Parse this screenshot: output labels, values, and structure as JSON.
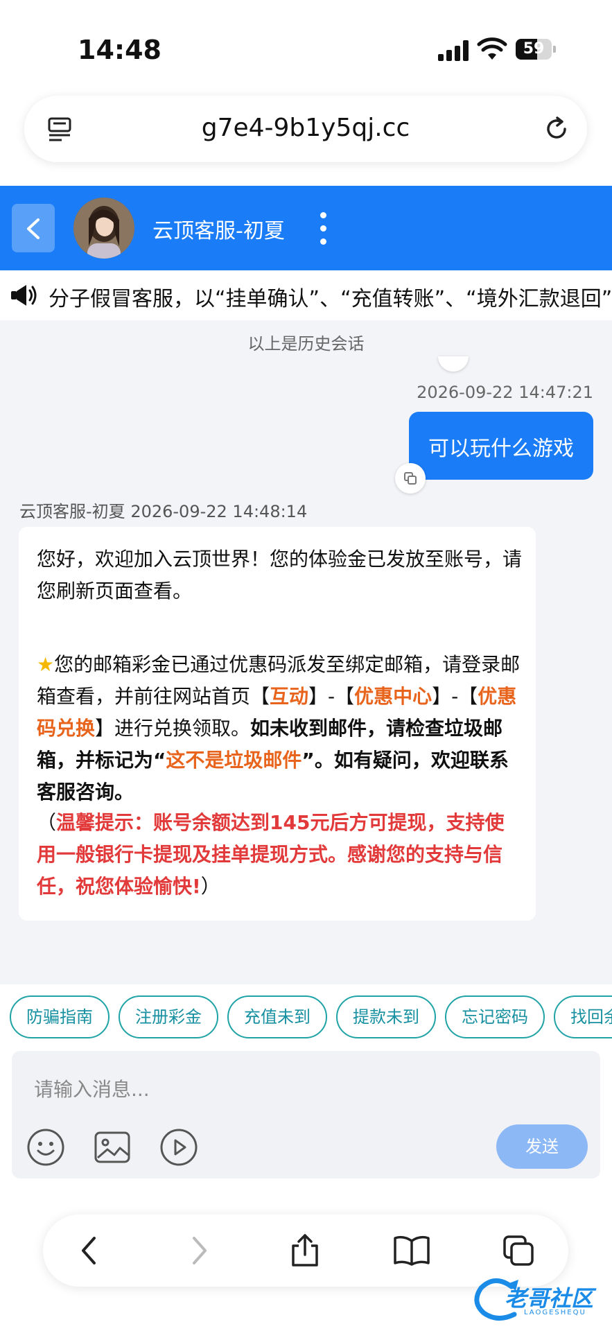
{
  "status_bar": {
    "time": "14:48",
    "battery": "59",
    "battery_level": 0.59
  },
  "browser": {
    "url": "g7e4-9b1y5qj.cc"
  },
  "chat_header": {
    "agent_name": "云顶客服-初夏"
  },
  "notice": {
    "text": "分子假冒客服，以“挂单确认”、“充值转账”、“境外汇款退回”"
  },
  "chat": {
    "history_label": "以上是历史会话",
    "user_message": {
      "timestamp": "2026-09-22 14:47:21",
      "text": "可以玩什么游戏"
    },
    "agent_message": {
      "sender": "云顶客服-初夏",
      "timestamp": "2026-09-22 14:48:14",
      "p1": "您好，欢迎加入云顶世界！您的体验金已发放至账号，请您刷新页面查看。",
      "p2_icon": "star-emoji",
      "p2_a": "您的邮箱彩金已通过优惠码派发至绑定邮箱，请登录邮箱查看，并前往网站首页【",
      "p2_hl1": "互动",
      "p2_b": "】-【",
      "p2_hl2": "优惠中心",
      "p2_c": "】-【",
      "p2_hl3": "优惠码兑换",
      "p2_d": "】进行兑换领取。",
      "p2_bold1": "如未收到邮件，请检查垃圾邮箱，并标记为“",
      "p2_hl4": "这不是垃圾邮件",
      "p2_bold2": "”。如有疑问，欢迎联系客服咨询。",
      "p3_open": "（",
      "p3_red": "温馨提示：账号余额达到145元后方可提现，支持使用一般银行卡提现及挂单提现方式。感谢您的支持与信任，祝您体验愉快!",
      "p3_close": "）"
    }
  },
  "quick_replies": [
    "防骗指南",
    "注册彩金",
    "充值未到",
    "提款未到",
    "忘记密码",
    "找回余额"
  ],
  "input": {
    "placeholder": "请输入消息...",
    "send_label": "发送"
  },
  "watermark": {
    "text": "老哥社区",
    "sub": "LAOGESHEQU"
  },
  "colors": {
    "accent": "#1a7cf7",
    "chip_border": "#1fa3a6",
    "highlight_orange": "#e8641c",
    "highlight_red": "#e23a3a",
    "send_disabled": "#8db8f6"
  }
}
